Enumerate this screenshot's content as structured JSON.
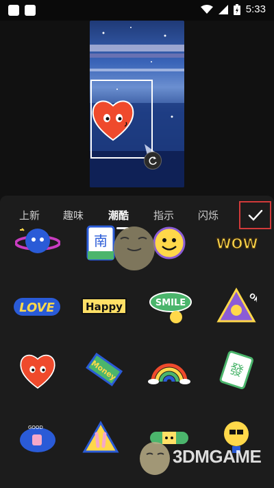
{
  "status_bar": {
    "time": "5:33",
    "icons": [
      "wifi-icon",
      "signal-icon",
      "battery-charging-icon"
    ]
  },
  "tabs": [
    {
      "label": "上新",
      "active": false
    },
    {
      "label": "趣味",
      "active": false
    },
    {
      "label": "潮酷",
      "active": true
    },
    {
      "label": "指示",
      "active": false
    },
    {
      "label": "闪烁",
      "active": false
    }
  ],
  "confirm_icon": "checkmark-icon",
  "stickers": [
    {
      "name": "planet-sticker"
    },
    {
      "name": "mahjong-nan-sticker",
      "text": "南"
    },
    {
      "name": "smiley-sticker"
    },
    {
      "name": "wow-sticker",
      "text": "WOW"
    },
    {
      "name": "love-sticker",
      "text": "LOVE"
    },
    {
      "name": "happy-sticker",
      "text": "Happy"
    },
    {
      "name": "smile-sticker",
      "text": "SMILE"
    },
    {
      "name": "ok-hand-sticker",
      "text": "OK!"
    },
    {
      "name": "heart-face-sticker"
    },
    {
      "name": "money-sticker",
      "text": "Money"
    },
    {
      "name": "rainbow-sticker"
    },
    {
      "name": "mahjong-fa-sticker",
      "text": "發"
    },
    {
      "name": "good-thumb-sticker",
      "text": "GOOD"
    },
    {
      "name": "peace-sign-sticker"
    },
    {
      "name": "bandage-sticker"
    },
    {
      "name": "sunglasses-bulb-sticker"
    }
  ],
  "watermark": {
    "text": "3DMGAME"
  },
  "colors": {
    "accent_red": "#d33a3a",
    "panel_bg": "#1c1c1c",
    "heart": "#ef4a2c"
  }
}
